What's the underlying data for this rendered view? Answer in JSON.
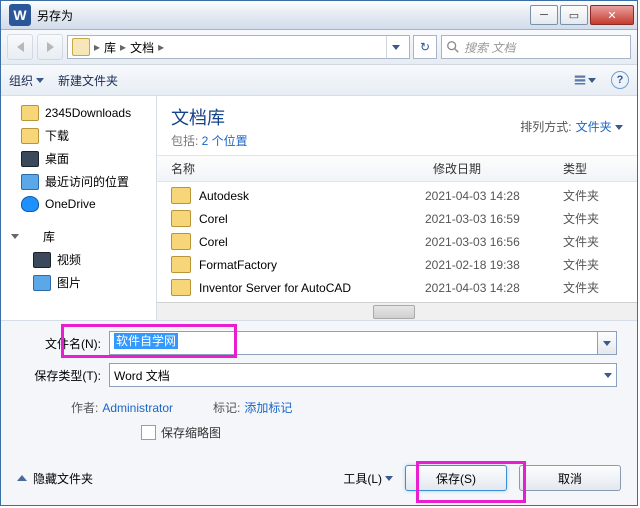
{
  "window": {
    "title": "另存为"
  },
  "nav": {
    "crumbs": [
      "库",
      "文档"
    ],
    "search_placeholder": "搜索 文档"
  },
  "toolbar": {
    "organize": "组织",
    "new_folder": "新建文件夹"
  },
  "sidebar": {
    "items": [
      {
        "label": "2345Downloads",
        "icon": "folder"
      },
      {
        "label": "下载",
        "icon": "folder-blue"
      },
      {
        "label": "桌面",
        "icon": "desktop"
      },
      {
        "label": "最近访问的位置",
        "icon": "recent"
      },
      {
        "label": "OneDrive",
        "icon": "cloud"
      }
    ],
    "group": {
      "label": "库"
    },
    "sub": [
      {
        "label": "视频",
        "icon": "video"
      },
      {
        "label": "图片",
        "icon": "image"
      }
    ]
  },
  "library": {
    "title": "文档库",
    "subtitle_prefix": "包括: ",
    "subtitle_link": "2 个位置",
    "sort_label": "排列方式:",
    "sort_value": "文件夹"
  },
  "columns": {
    "name": "名称",
    "date": "修改日期",
    "type": "类型"
  },
  "files": [
    {
      "name": "Autodesk",
      "date": "2021-04-03 14:28",
      "type": "文件夹"
    },
    {
      "name": "Corel",
      "date": "2021-03-03 16:59",
      "type": "文件夹"
    },
    {
      "name": "Corel",
      "date": "2021-03-03 16:56",
      "type": "文件夹"
    },
    {
      "name": "FormatFactory",
      "date": "2021-02-18 19:38",
      "type": "文件夹"
    },
    {
      "name": "Inventor Server for AutoCAD",
      "date": "2021-04-03 14:28",
      "type": "文件夹"
    }
  ],
  "form": {
    "filename_label": "文件名(N):",
    "filename_value": "软件自学网",
    "filetype_label": "保存类型(T):",
    "filetype_value": "Word 文档",
    "author_label": "作者:",
    "author_value": "Administrator",
    "tags_label": "标记:",
    "tags_value": "添加标记",
    "thumb_label": "保存缩略图"
  },
  "footer": {
    "hide_folders": "隐藏文件夹",
    "tools": "工具(L)",
    "save": "保存(S)",
    "cancel": "取消"
  }
}
